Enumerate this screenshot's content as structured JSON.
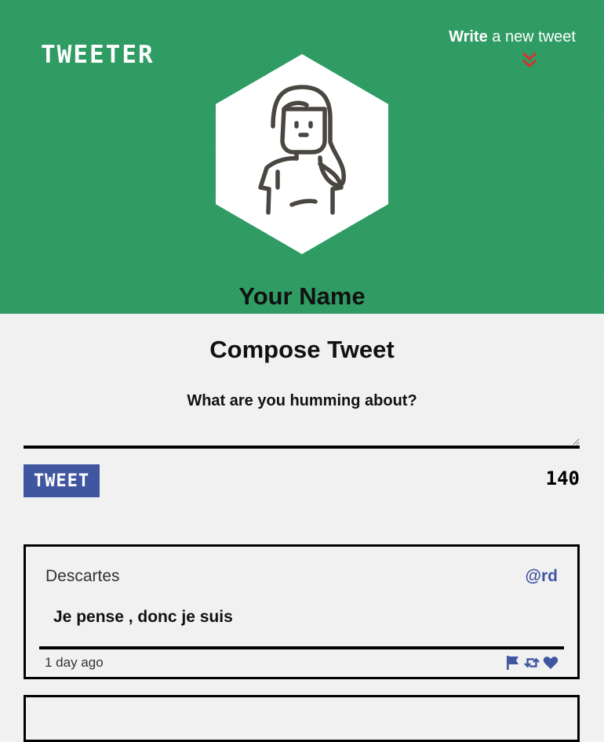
{
  "app": {
    "logo": "TWEETER"
  },
  "nav": {
    "write_strong": "Write",
    "write_rest": " a new tweet"
  },
  "profile": {
    "name": "Your Name",
    "avatar_icon": "woman-avatar-icon"
  },
  "compose": {
    "title": "Compose Tweet",
    "label": "What are you humming about?",
    "textarea_value": "",
    "button_label": "TWEET",
    "counter": "140"
  },
  "tweets": [
    {
      "author": "Descartes",
      "handle": "@rd",
      "text": "Je pense , donc je suis",
      "time": "1 day ago",
      "actions": [
        "flag-icon",
        "retweet-icon",
        "heart-icon"
      ]
    }
  ],
  "colors": {
    "header_green": "#2e9c63",
    "accent_blue": "#4156a1",
    "chevron_red": "#d0342c",
    "background": "#f1f1f1"
  }
}
